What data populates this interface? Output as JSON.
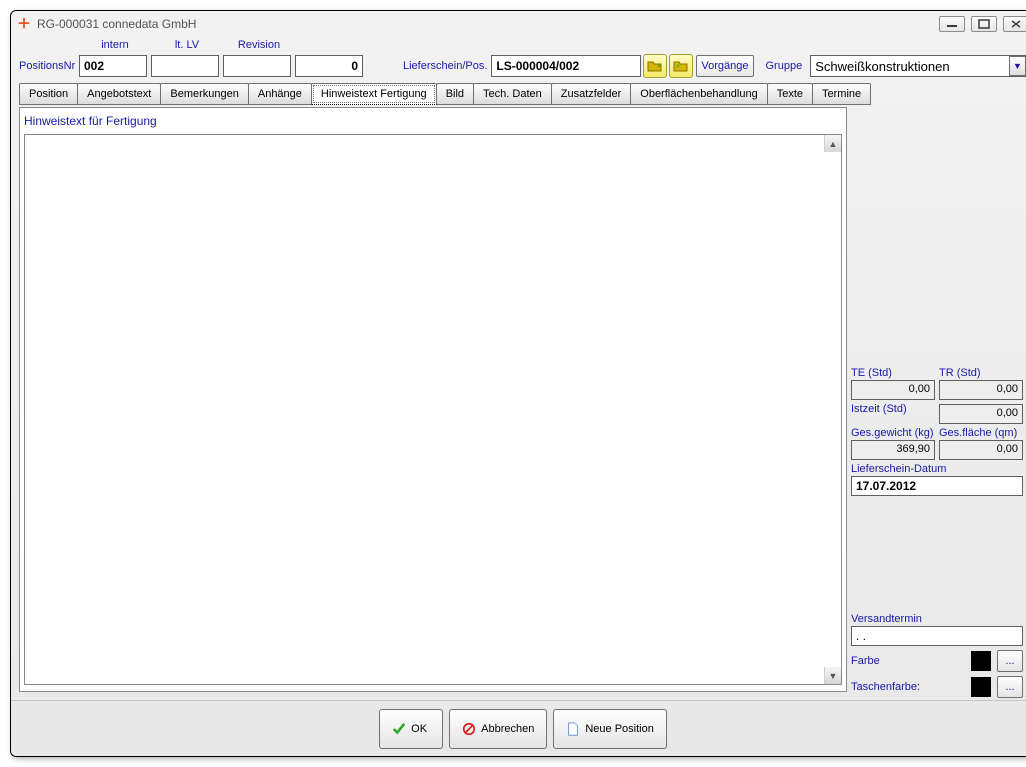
{
  "window": {
    "title": "RG-000031 connedata GmbH"
  },
  "header": {
    "labels": {
      "positionsnr": "PositionsNr",
      "intern": "intern",
      "ltlv": "lt. LV",
      "revision": "Revision",
      "lieferschein": "Lieferschein/Pos.",
      "vorgaenge": "Vorgänge",
      "gruppe": "Gruppe"
    },
    "values": {
      "positionsnr": "002",
      "intern": "",
      "ltlv": "",
      "revision": "0",
      "lieferschein": "LS-000004/002",
      "gruppe": "Schweißkonstruktionen"
    }
  },
  "tabs": [
    "Position",
    "Angebotstext",
    "Bemerkungen",
    "Anhänge",
    "Hinweistext Fertigung",
    "Bild",
    "Tech. Daten",
    "Zusatzfelder",
    "Oberflächenbehandlung",
    "Texte",
    "Termine"
  ],
  "activeTab": 4,
  "panel": {
    "title": "Hinweistext für Fertigung",
    "text": ""
  },
  "side": {
    "te": {
      "label": "TE (Std)",
      "value": "0,00"
    },
    "tr": {
      "label": "TR (Std)",
      "value": "0,00"
    },
    "istzeit": {
      "label": "Istzeit (Std)",
      "value": "0,00"
    },
    "gewicht": {
      "label": "Ges.gewicht (kg)",
      "value": "369,90"
    },
    "flaeche": {
      "label": "Ges.fläche (qm)",
      "value": "0,00"
    },
    "lieferdatum": {
      "label": "Lieferschein-Datum",
      "value": "17.07.2012"
    },
    "versand": {
      "label": "Versandtermin",
      "value": ".  ."
    },
    "farbe": {
      "label": "Farbe",
      "value": "#000000"
    },
    "taschenfarbe": {
      "label": "Taschenfarbe:",
      "value": "#000000"
    },
    "dots": "..."
  },
  "footer": {
    "ok": "OK",
    "abbrechen": "Abbrechen",
    "neue": "Neue Position"
  }
}
